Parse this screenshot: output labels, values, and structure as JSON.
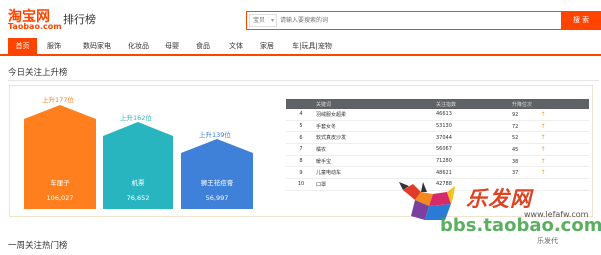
{
  "header": {
    "logo_main": "淘宝网",
    "logo_sub": "Taobao.com",
    "page_name": "排行榜",
    "search": {
      "scope": "宝贝",
      "placeholder": "请输入要搜索的词",
      "button": "搜 索"
    }
  },
  "nav": {
    "items": [
      "首页",
      "服饰",
      "数码家电",
      "化妆品",
      "母婴",
      "食品",
      "文体",
      "家居",
      "车|玩具|宠物"
    ],
    "active_index": 0
  },
  "section_rising": {
    "title": "今日关注上升榜",
    "podium": [
      {
        "rank": 1,
        "rise": "上升177位",
        "name": "车厘子",
        "value": "106,027",
        "color": "#ff7f1e"
      },
      {
        "rank": 2,
        "rise": "上升162位",
        "name": "机票",
        "value": "76,652",
        "color": "#29b5c0"
      },
      {
        "rank": 3,
        "rise": "上升139位",
        "name": "狮王祛痘膏",
        "value": "56,997",
        "color": "#3f80d8"
      }
    ],
    "table": {
      "headers": [
        "",
        "关键词",
        "关注指数",
        "升降位次"
      ],
      "rows": [
        {
          "rank": "4",
          "keyword": "羽绒服女超柔",
          "index": "46613",
          "change": "92"
        },
        {
          "rank": "5",
          "keyword": "手套女冬",
          "index": "53130",
          "change": "72"
        },
        {
          "rank": "6",
          "keyword": "软式真皮沙发",
          "index": "37044",
          "change": "52"
        },
        {
          "rank": "7",
          "keyword": "橘农",
          "index": "56067",
          "change": "45"
        },
        {
          "rank": "8",
          "keyword": "暖手宝",
          "index": "71280",
          "change": "38"
        },
        {
          "rank": "9",
          "keyword": "儿童电动车",
          "index": "48621",
          "change": "37"
        },
        {
          "rank": "10",
          "keyword": "口罩",
          "index": "42788",
          "change": ""
        }
      ],
      "up_arrow": "↑",
      "arrow_color": "#f0a020"
    }
  },
  "section_weekly": {
    "title": "一周关注热门榜"
  },
  "watermark": {
    "brand": "乐发网",
    "url": "bbs.taobao.com",
    "url_alt": "www.lefafw.com",
    "tag": "乐发代"
  },
  "colors": {
    "accent": "#ff4400",
    "table_header": "#5e6166"
  }
}
